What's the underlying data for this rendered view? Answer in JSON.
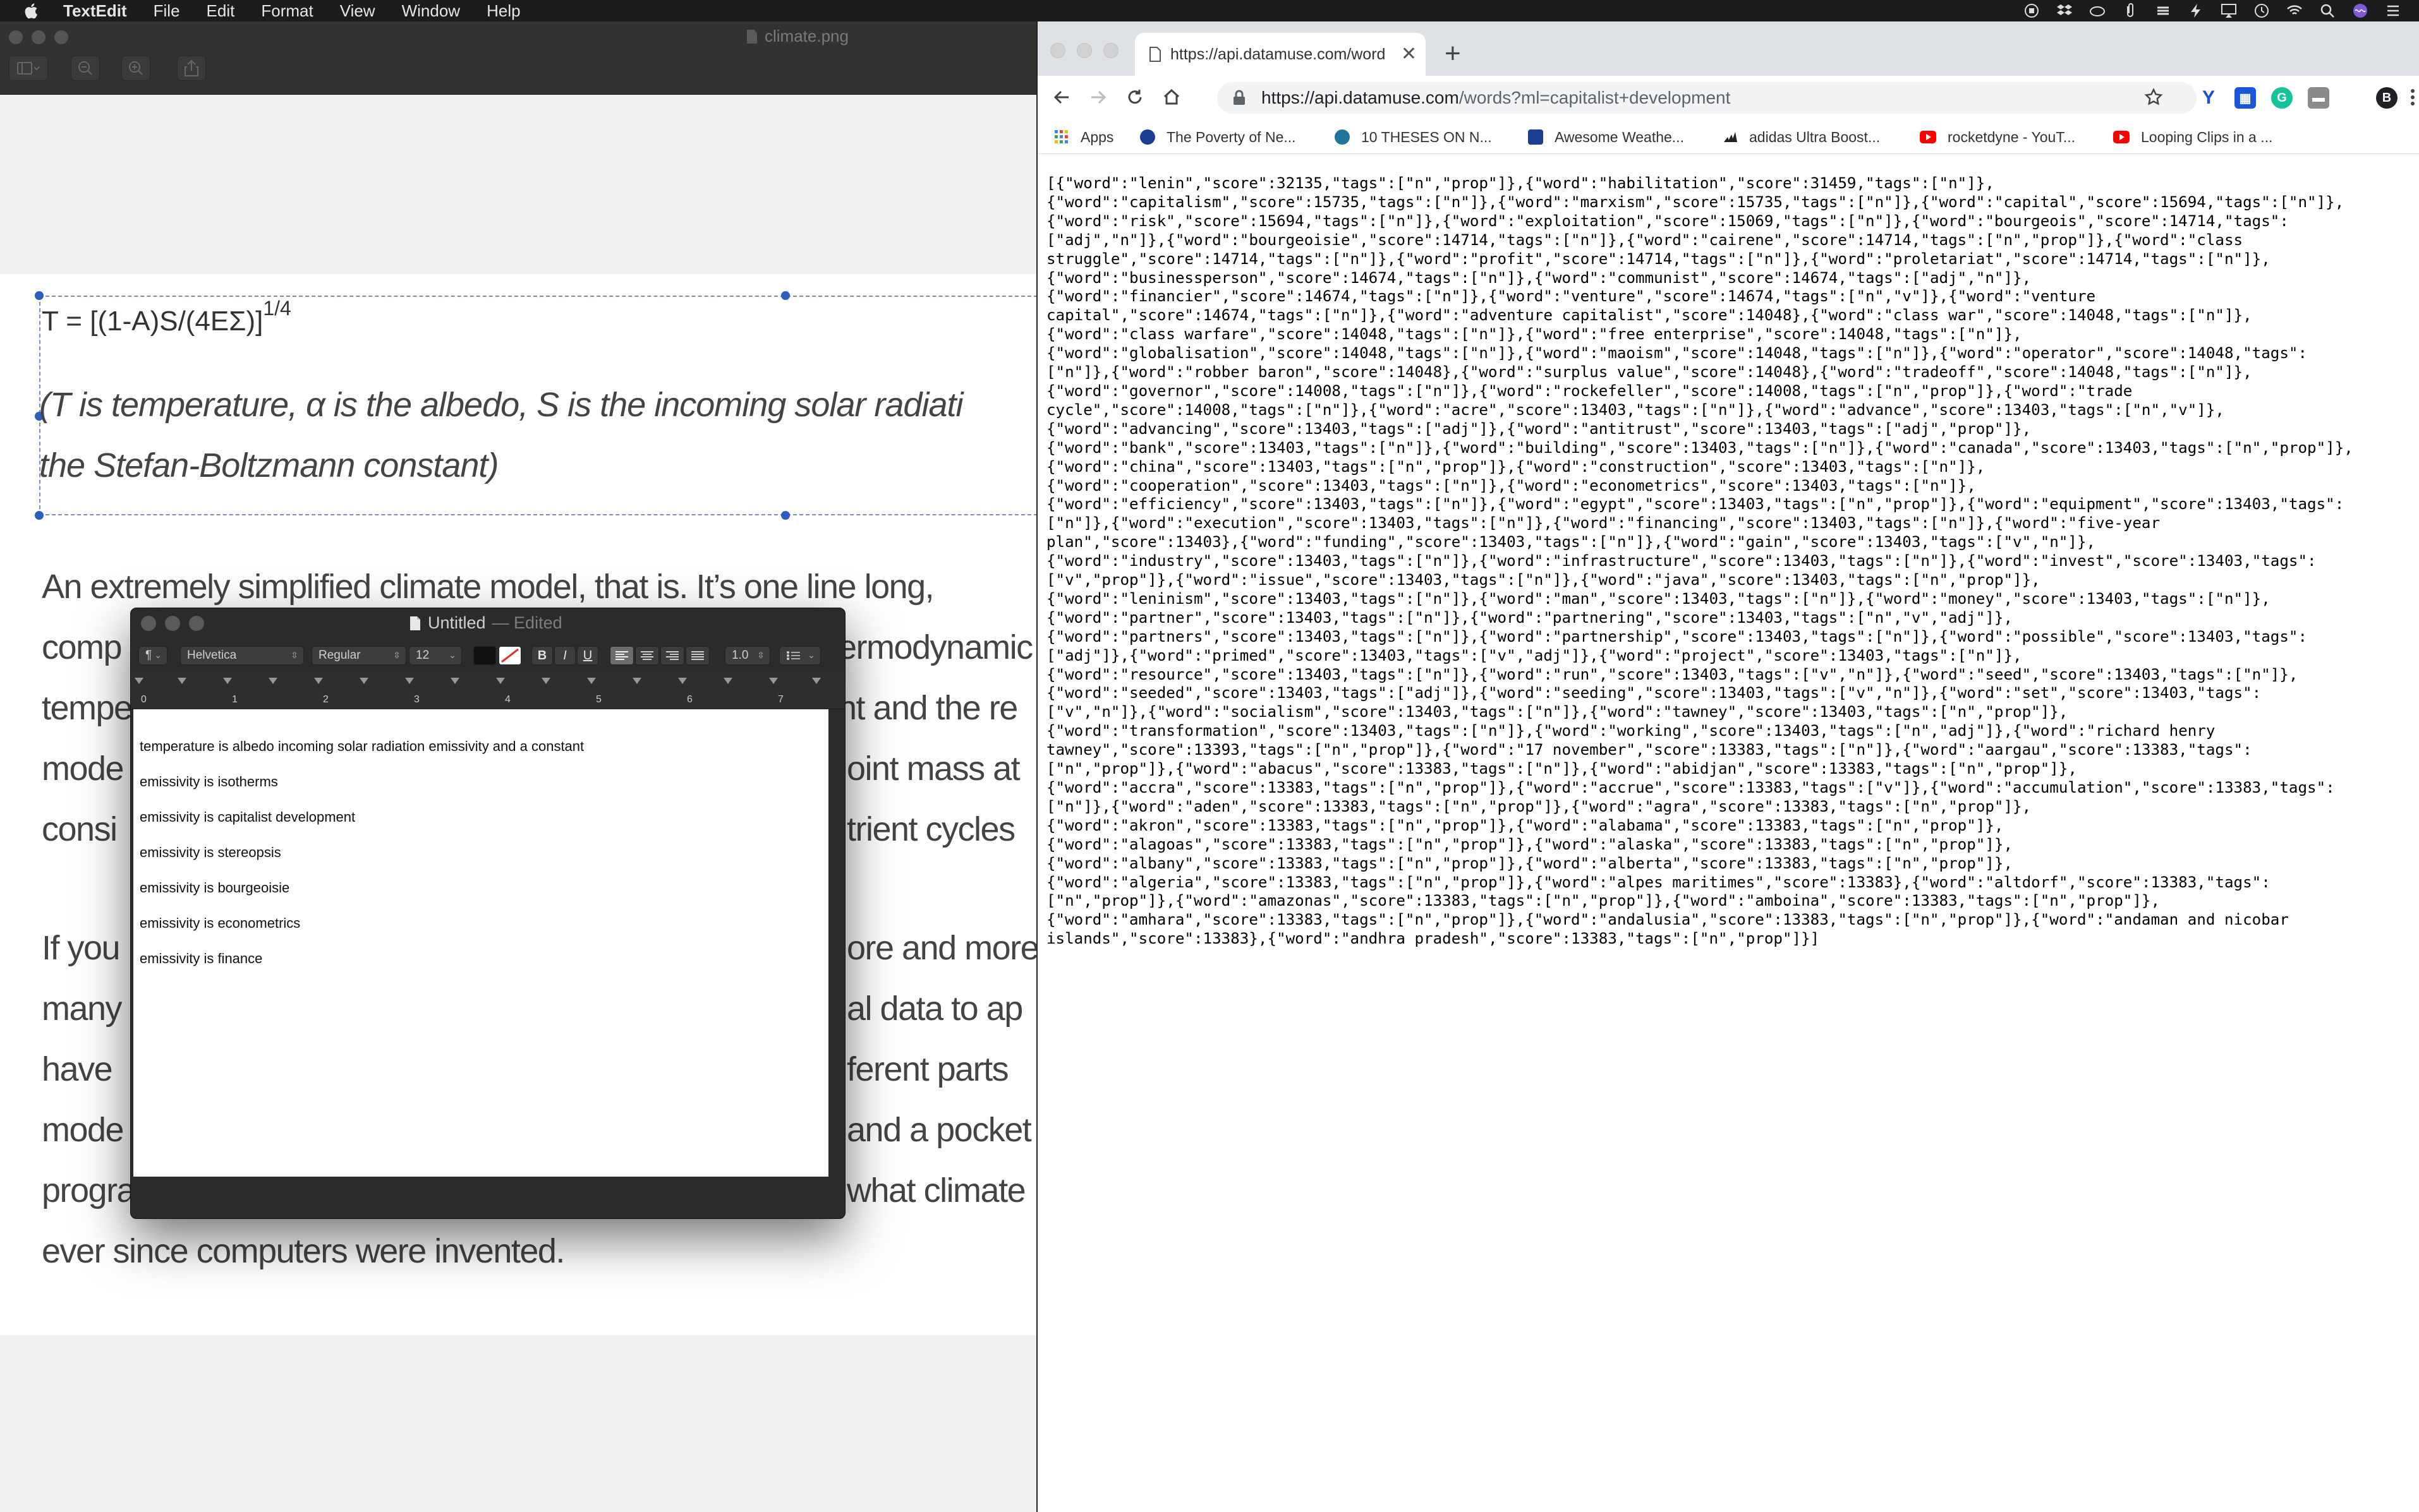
{
  "menubar": {
    "app": "TextEdit",
    "items": [
      "File",
      "Edit",
      "Format",
      "View",
      "Window",
      "Help"
    ]
  },
  "preview": {
    "title": "climate.png",
    "formula_main": "T = [(1-A)S/(4EΣ)]",
    "formula_exp": "1/4",
    "caption_line1": "(T is temperature, α is the albedo, S is the incoming solar radiati",
    "caption_line2": "the Stefan-Boltzmann constant)",
    "para1_lines": [
      "An extremely simplified climate model, that is. It’s one line long,",
      "comp",
      "tempe",
      "mode",
      "consi"
    ],
    "para1_right": [
      "ermodynamic",
      "nt and the re",
      "oint mass at",
      "trient cycles"
    ],
    "para2_lines": [
      "If you",
      "many",
      "have",
      "mode",
      "progra",
      "ever since computers were invented."
    ],
    "para2_right": [
      "ore and more",
      "al data to ap",
      "ferent parts",
      "and a pocket",
      "what climate"
    ]
  },
  "textedit": {
    "title": "Untitled",
    "edited": "— Edited",
    "paragraph_style": "¶",
    "font_family": "Helvetica",
    "font_style": "Regular",
    "font_size": "12",
    "bold": "B",
    "italic": "I",
    "underline": "U",
    "line_spacing": "1.0",
    "ruler_numbers": [
      "0",
      "1",
      "2",
      "3",
      "4",
      "5",
      "6",
      "7"
    ],
    "lines": [
      "temperature is albedo incoming solar radiation emissivity and a constant",
      "emissivity is isotherms",
      "emissivity is capitalist development",
      "emissivity is stereopsis",
      "emissivity is bourgeoisie",
      "emissivity is econometrics",
      "emissivity is finance"
    ]
  },
  "chrome": {
    "tab_title": "https://api.datamuse.com/word",
    "url_host": "https://api.datamuse.com",
    "url_path": "/words?ml=capitalist+development",
    "profile": "B",
    "bookmarks": [
      {
        "label": "Apps",
        "color": "#4285f4"
      },
      {
        "label": "The Poverty of Ne...",
        "color": "#1a3d8f"
      },
      {
        "label": "10 THESES ON N...",
        "color": "#21759b"
      },
      {
        "label": "Awesome Weathe...",
        "color": "#1c3f94"
      },
      {
        "label": "adidas Ultra Boost...",
        "color": "#222222"
      },
      {
        "label": "rocketdyne - YouT...",
        "color": "#ff0000"
      },
      {
        "label": "Looping Clips in a ...",
        "color": "#ff0000"
      }
    ],
    "json_lines": [
      "[{\"word\":\"lenin\",\"score\":32135,\"tags\":[\"n\",\"prop\"]},{\"word\":\"habilitation\",\"score\":31459,\"tags\":[\"n\"]},",
      "{\"word\":\"capitalism\",\"score\":15735,\"tags\":[\"n\"]},{\"word\":\"marxism\",\"score\":15735,\"tags\":[\"n\"]},{\"word\":\"capital\",\"score\":15694,\"tags\":[\"n\"]},",
      "{\"word\":\"risk\",\"score\":15694,\"tags\":[\"n\"]},{\"word\":\"exploitation\",\"score\":15069,\"tags\":[\"n\"]},{\"word\":\"bourgeois\",\"score\":14714,\"tags\":",
      "[\"adj\",\"n\"]},{\"word\":\"bourgeoisie\",\"score\":14714,\"tags\":[\"n\"]},{\"word\":\"cairene\",\"score\":14714,\"tags\":[\"n\",\"prop\"]},{\"word\":\"class",
      "struggle\",\"score\":14714,\"tags\":[\"n\"]},{\"word\":\"profit\",\"score\":14714,\"tags\":[\"n\"]},{\"word\":\"proletariat\",\"score\":14714,\"tags\":[\"n\"]},",
      "{\"word\":\"businessperson\",\"score\":14674,\"tags\":[\"n\"]},{\"word\":\"communist\",\"score\":14674,\"tags\":[\"adj\",\"n\"]},",
      "{\"word\":\"financier\",\"score\":14674,\"tags\":[\"n\"]},{\"word\":\"venture\",\"score\":14674,\"tags\":[\"n\",\"v\"]},{\"word\":\"venture",
      "capital\",\"score\":14674,\"tags\":[\"n\"]},{\"word\":\"adventure capitalist\",\"score\":14048},{\"word\":\"class war\",\"score\":14048,\"tags\":[\"n\"]},",
      "{\"word\":\"class warfare\",\"score\":14048,\"tags\":[\"n\"]},{\"word\":\"free enterprise\",\"score\":14048,\"tags\":[\"n\"]},",
      "{\"word\":\"globalisation\",\"score\":14048,\"tags\":[\"n\"]},{\"word\":\"maoism\",\"score\":14048,\"tags\":[\"n\"]},{\"word\":\"operator\",\"score\":14048,\"tags\":",
      "[\"n\"]},{\"word\":\"robber baron\",\"score\":14048},{\"word\":\"surplus value\",\"score\":14048},{\"word\":\"tradeoff\",\"score\":14048,\"tags\":[\"n\"]},",
      "{\"word\":\"governor\",\"score\":14008,\"tags\":[\"n\"]},{\"word\":\"rockefeller\",\"score\":14008,\"tags\":[\"n\",\"prop\"]},{\"word\":\"trade",
      "cycle\",\"score\":14008,\"tags\":[\"n\"]},{\"word\":\"acre\",\"score\":13403,\"tags\":[\"n\"]},{\"word\":\"advance\",\"score\":13403,\"tags\":[\"n\",\"v\"]},",
      "{\"word\":\"advancing\",\"score\":13403,\"tags\":[\"adj\"]},{\"word\":\"antitrust\",\"score\":13403,\"tags\":[\"adj\",\"prop\"]},",
      "{\"word\":\"bank\",\"score\":13403,\"tags\":[\"n\"]},{\"word\":\"building\",\"score\":13403,\"tags\":[\"n\"]},{\"word\":\"canada\",\"score\":13403,\"tags\":[\"n\",\"prop\"]},",
      "{\"word\":\"china\",\"score\":13403,\"tags\":[\"n\",\"prop\"]},{\"word\":\"construction\",\"score\":13403,\"tags\":[\"n\"]},",
      "{\"word\":\"cooperation\",\"score\":13403,\"tags\":[\"n\"]},{\"word\":\"econometrics\",\"score\":13403,\"tags\":[\"n\"]},",
      "{\"word\":\"efficiency\",\"score\":13403,\"tags\":[\"n\"]},{\"word\":\"egypt\",\"score\":13403,\"tags\":[\"n\",\"prop\"]},{\"word\":\"equipment\",\"score\":13403,\"tags\":",
      "[\"n\"]},{\"word\":\"execution\",\"score\":13403,\"tags\":[\"n\"]},{\"word\":\"financing\",\"score\":13403,\"tags\":[\"n\"]},{\"word\":\"five-year",
      "plan\",\"score\":13403},{\"word\":\"funding\",\"score\":13403,\"tags\":[\"n\"]},{\"word\":\"gain\",\"score\":13403,\"tags\":[\"v\",\"n\"]},",
      "{\"word\":\"industry\",\"score\":13403,\"tags\":[\"n\"]},{\"word\":\"infrastructure\",\"score\":13403,\"tags\":[\"n\"]},{\"word\":\"invest\",\"score\":13403,\"tags\":",
      "[\"v\",\"prop\"]},{\"word\":\"issue\",\"score\":13403,\"tags\":[\"n\"]},{\"word\":\"java\",\"score\":13403,\"tags\":[\"n\",\"prop\"]},",
      "{\"word\":\"leninism\",\"score\":13403,\"tags\":[\"n\"]},{\"word\":\"man\",\"score\":13403,\"tags\":[\"n\"]},{\"word\":\"money\",\"score\":13403,\"tags\":[\"n\"]},",
      "{\"word\":\"partner\",\"score\":13403,\"tags\":[\"n\"]},{\"word\":\"partnering\",\"score\":13403,\"tags\":[\"n\",\"v\",\"adj\"]},",
      "{\"word\":\"partners\",\"score\":13403,\"tags\":[\"n\"]},{\"word\":\"partnership\",\"score\":13403,\"tags\":[\"n\"]},{\"word\":\"possible\",\"score\":13403,\"tags\":",
      "[\"adj\"]},{\"word\":\"primed\",\"score\":13403,\"tags\":[\"v\",\"adj\"]},{\"word\":\"project\",\"score\":13403,\"tags\":[\"n\"]},",
      "{\"word\":\"resource\",\"score\":13403,\"tags\":[\"n\"]},{\"word\":\"run\",\"score\":13403,\"tags\":[\"v\",\"n\"]},{\"word\":\"seed\",\"score\":13403,\"tags\":[\"n\"]},",
      "{\"word\":\"seeded\",\"score\":13403,\"tags\":[\"adj\"]},{\"word\":\"seeding\",\"score\":13403,\"tags\":[\"v\",\"n\"]},{\"word\":\"set\",\"score\":13403,\"tags\":",
      "[\"v\",\"n\"]},{\"word\":\"socialism\",\"score\":13403,\"tags\":[\"n\"]},{\"word\":\"tawney\",\"score\":13403,\"tags\":[\"n\",\"prop\"]},",
      "{\"word\":\"transformation\",\"score\":13403,\"tags\":[\"n\"]},{\"word\":\"working\",\"score\":13403,\"tags\":[\"n\",\"adj\"]},{\"word\":\"richard henry",
      "tawney\",\"score\":13393,\"tags\":[\"n\",\"prop\"]},{\"word\":\"17 november\",\"score\":13383,\"tags\":[\"n\"]},{\"word\":\"aargau\",\"score\":13383,\"tags\":",
      "[\"n\",\"prop\"]},{\"word\":\"abacus\",\"score\":13383,\"tags\":[\"n\"]},{\"word\":\"abidjan\",\"score\":13383,\"tags\":[\"n\",\"prop\"]},",
      "{\"word\":\"accra\",\"score\":13383,\"tags\":[\"n\",\"prop\"]},{\"word\":\"accrue\",\"score\":13383,\"tags\":[\"v\"]},{\"word\":\"accumulation\",\"score\":13383,\"tags\":",
      "[\"n\"]},{\"word\":\"aden\",\"score\":13383,\"tags\":[\"n\",\"prop\"]},{\"word\":\"agra\",\"score\":13383,\"tags\":[\"n\",\"prop\"]},",
      "{\"word\":\"akron\",\"score\":13383,\"tags\":[\"n\",\"prop\"]},{\"word\":\"alabama\",\"score\":13383,\"tags\":[\"n\",\"prop\"]},",
      "{\"word\":\"alagoas\",\"score\":13383,\"tags\":[\"n\",\"prop\"]},{\"word\":\"alaska\",\"score\":13383,\"tags\":[\"n\",\"prop\"]},",
      "{\"word\":\"albany\",\"score\":13383,\"tags\":[\"n\",\"prop\"]},{\"word\":\"alberta\",\"score\":13383,\"tags\":[\"n\",\"prop\"]},",
      "{\"word\":\"algeria\",\"score\":13383,\"tags\":[\"n\",\"prop\"]},{\"word\":\"alpes maritimes\",\"score\":13383},{\"word\":\"altdorf\",\"score\":13383,\"tags\":",
      "[\"n\",\"prop\"]},{\"word\":\"amazonas\",\"score\":13383,\"tags\":[\"n\",\"prop\"]},{\"word\":\"amboina\",\"score\":13383,\"tags\":[\"n\",\"prop\"]},",
      "{\"word\":\"amhara\",\"score\":13383,\"tags\":[\"n\",\"prop\"]},{\"word\":\"andalusia\",\"score\":13383,\"tags\":[\"n\",\"prop\"]},{\"word\":\"andaman and nicobar",
      "islands\",\"score\":13383},{\"word\":\"andhra pradesh\",\"score\":13383,\"tags\":[\"n\",\"prop\"]}]"
    ]
  }
}
